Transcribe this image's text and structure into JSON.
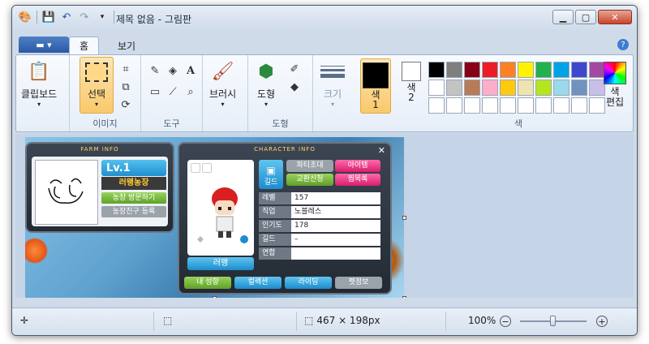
{
  "window": {
    "title": "제목 없음 - 그림판"
  },
  "tabs": {
    "home": "홈",
    "view": "보기"
  },
  "ribbon": {
    "clipboard": {
      "label": "클립보드"
    },
    "image": {
      "select_label": "선택",
      "group_label": "이미지"
    },
    "tools": {
      "group_label": "도구"
    },
    "brushes": {
      "label": "브러시"
    },
    "shapes": {
      "label": "도형",
      "group_label": "도형"
    },
    "size": {
      "label": "크기"
    },
    "color1": {
      "label": "색\n1"
    },
    "color2": {
      "label": "색\n2"
    },
    "edit_colors": {
      "label": "색\n편집"
    },
    "colors_group_label": "색"
  },
  "palette": [
    "#000000",
    "#7f7f7f",
    "#880015",
    "#ed1c24",
    "#ff7f27",
    "#fff200",
    "#22b14c",
    "#00a2e8",
    "#3f48cc",
    "#a349a4",
    "#ffffff",
    "#c3c3c3",
    "#b97a57",
    "#ffaec9",
    "#ffc90e",
    "#efe4b0",
    "#b5e61d",
    "#99d9ea",
    "#7092be",
    "#c8bfe7",
    "#ffffff",
    "#ffffff",
    "#ffffff",
    "#ffffff",
    "#ffffff",
    "#ffffff",
    "#ffffff",
    "#ffffff",
    "#ffffff",
    "#ffffff"
  ],
  "colors": {
    "color1": "#000000",
    "color2": "#ffffff",
    "accent": "#2a5aa6"
  },
  "image": {
    "farm_info": {
      "title": "FARM INFO",
      "level": "Lv.1",
      "farm_name": "러왱농장",
      "visit_button": "농장 방문하기",
      "register_button": "농장친구 등록"
    },
    "character_info": {
      "title": "CHARACTER INFO",
      "close": "✕",
      "guild_button": "길드",
      "party_button": "파티초대",
      "trade_button": "교환신청",
      "item_button": "아이템",
      "zzim_button": "찜목록",
      "character_name": "러왱",
      "stats": [
        {
          "key": "레벨",
          "value": "157"
        },
        {
          "key": "직업",
          "value": "노블레스"
        },
        {
          "key": "인기도",
          "value": "178"
        },
        {
          "key": "길드",
          "value": "–"
        },
        {
          "key": "연합",
          "value": ""
        }
      ],
      "bottom_buttons": [
        "내 성향",
        "컬렉션",
        "라이딩",
        "펫정보"
      ]
    }
  },
  "status": {
    "image_size": "467 × 198px",
    "zoom": "100%",
    "zoom_level": 0.5
  }
}
